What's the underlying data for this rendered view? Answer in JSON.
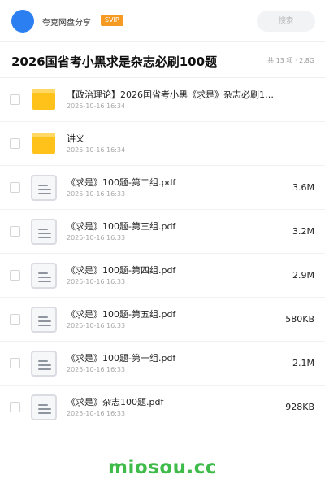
{
  "header": {
    "share_name": "夸克网盘分享",
    "badge": "SVIP",
    "search_placeholder": "搜索"
  },
  "folder": {
    "title": "2026国省考小黑求是杂志必刷100题",
    "summary": "共 13 项 · 2.8G"
  },
  "files": [
    {
      "type": "folder",
      "name": "【政治理论】2026国省考小黑《求是》杂志必刷10…",
      "date": "2025-10-16 16:34",
      "size": ""
    },
    {
      "type": "folder",
      "name": "讲义",
      "date": "2025-10-16 16:34",
      "size": ""
    },
    {
      "type": "doc",
      "name": "《求是》100题-第二组.pdf",
      "date": "2025-10-16 16:33",
      "size": "3.6M"
    },
    {
      "type": "doc",
      "name": "《求是》100题-第三组.pdf",
      "date": "2025-10-16 16:33",
      "size": "3.2M"
    },
    {
      "type": "doc",
      "name": "《求是》100题-第四组.pdf",
      "date": "2025-10-16 16:33",
      "size": "2.9M"
    },
    {
      "type": "doc",
      "name": "《求是》100题-第五组.pdf",
      "date": "2025-10-16 16:33",
      "size": "580KB"
    },
    {
      "type": "doc",
      "name": "《求是》100题-第一组.pdf",
      "date": "2025-10-16 16:33",
      "size": "2.1M"
    },
    {
      "type": "doc",
      "name": "《求是》杂志100题.pdf",
      "date": "2025-10-16 16:33",
      "size": "928KB"
    }
  ],
  "footer": {
    "watermark": "miosou.cc"
  },
  "colors": {
    "accent": "#2c7ff0",
    "svip": "#f59a23",
    "folder": "#ffc21a",
    "watermark": "#3fbb4a"
  }
}
